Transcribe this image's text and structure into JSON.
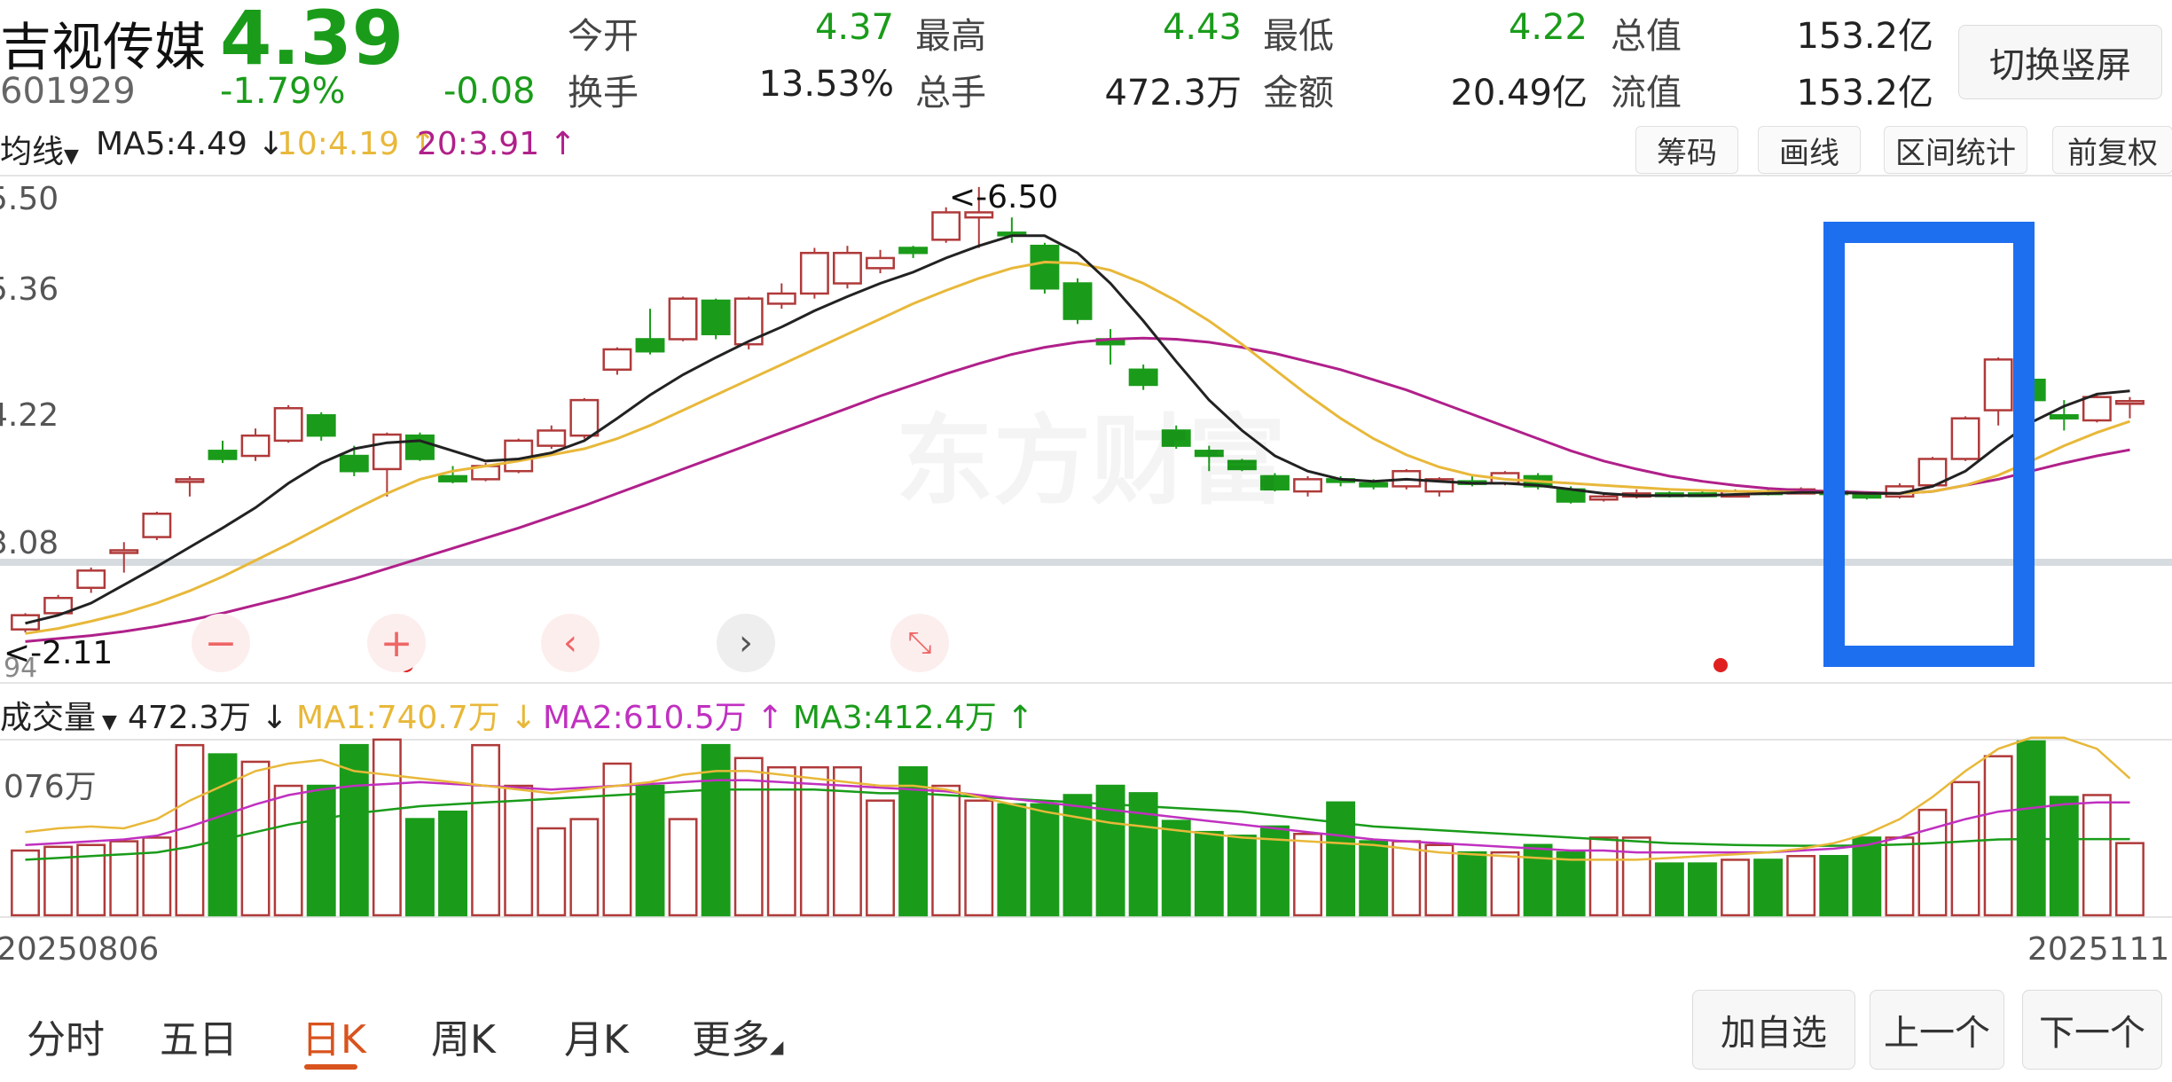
{
  "header": {
    "name": "吉视传媒",
    "price": "4.39",
    "code": "601929",
    "change_pct": "-1.79%",
    "change": "-0.08",
    "quotes": [
      {
        "label": "今开",
        "value": "4.37",
        "color": "#1a9c1a"
      },
      {
        "label": "最高",
        "value": "4.43",
        "color": "#1a9c1a"
      },
      {
        "label": "最低",
        "value": "4.22",
        "color": "#1a9c1a"
      },
      {
        "label": "总值",
        "value": "153.2亿",
        "color": "#222222"
      },
      {
        "label": "换手",
        "value": "13.53%",
        "color": "#222222"
      },
      {
        "label": "总手",
        "value": "472.3万",
        "color": "#222222"
      },
      {
        "label": "金额",
        "value": "20.49亿",
        "color": "#222222"
      },
      {
        "label": "流值",
        "value": "153.2亿",
        "color": "#222222"
      }
    ],
    "switch_button": "切换竖屏"
  },
  "ma_bar": {
    "selector": "均线",
    "ma5": "MA5:4.49",
    "ma10": "10:4.19",
    "ma20": "20:3.91",
    "ma5_color": "#222222",
    "ma10_color": "#e8b83a",
    "ma20_color": "#b0208a",
    "tools": [
      "筹码",
      "画线",
      "区间统计",
      "前复权"
    ]
  },
  "price_axis": [
    "5.50",
    "5.36",
    "4.22",
    "3.08"
  ],
  "markers": {
    "high": "<-6.50",
    "low": "<-2.11",
    "low_partial": "94"
  },
  "watermark": "东方财富",
  "volume_bar": {
    "selector": "成交量",
    "volume": "472.3万",
    "ma1": "MA1:740.7万",
    "ma2": "MA2:610.5万",
    "ma3": "MA3:412.4万",
    "ma1_color": "#e8b83a",
    "ma2_color": "#c030c0",
    "ma3_color": "#1a9c1a",
    "axis_label": "076万"
  },
  "dates": {
    "start": "20250806",
    "end": "20251111"
  },
  "tabs": [
    "分时",
    "五日",
    "日K",
    "周K",
    "月K",
    "更多"
  ],
  "active_tab": "日K",
  "bottom_buttons": [
    "加自选",
    "上一个",
    "下一个"
  ],
  "colors": {
    "up": "#b03a3a",
    "down": "#1a9c1a",
    "highlight": "#1e6ff0"
  },
  "chart_data": {
    "type": "candlestick",
    "dates_range": [
      "20250806",
      "20251111"
    ],
    "candles": [
      {
        "o": 2.14,
        "c": 2.28,
        "h": 2.3,
        "l": 2.11
      },
      {
        "o": 2.3,
        "c": 2.45,
        "h": 2.48,
        "l": 2.28
      },
      {
        "o": 2.55,
        "c": 2.72,
        "h": 2.75,
        "l": 2.5
      },
      {
        "o": 2.9,
        "c": 2.92,
        "h": 3.0,
        "l": 2.7
      },
      {
        "o": 3.05,
        "c": 3.28,
        "h": 3.3,
        "l": 3.02
      },
      {
        "o": 3.6,
        "c": 3.62,
        "h": 3.65,
        "l": 3.45
      },
      {
        "o": 3.9,
        "c": 3.82,
        "h": 4.0,
        "l": 3.78
      },
      {
        "o": 3.85,
        "c": 4.05,
        "h": 4.12,
        "l": 3.8
      },
      {
        "o": 4.0,
        "c": 4.32,
        "h": 4.35,
        "l": 3.98
      },
      {
        "o": 4.25,
        "c": 4.05,
        "h": 4.28,
        "l": 4.0
      },
      {
        "o": 3.85,
        "c": 3.7,
        "h": 3.95,
        "l": 3.65
      },
      {
        "o": 3.72,
        "c": 4.06,
        "h": 4.08,
        "l": 3.45
      },
      {
        "o": 4.05,
        "c": 3.82,
        "h": 4.08,
        "l": 3.8
      },
      {
        "o": 3.65,
        "c": 3.6,
        "h": 3.75,
        "l": 3.58
      },
      {
        "o": 3.62,
        "c": 3.75,
        "h": 3.78,
        "l": 3.6
      },
      {
        "o": 3.7,
        "c": 4.0,
        "h": 4.02,
        "l": 3.68
      },
      {
        "o": 3.95,
        "c": 4.1,
        "h": 4.15,
        "l": 3.92
      },
      {
        "o": 4.05,
        "c": 4.4,
        "h": 4.42,
        "l": 4.02
      },
      {
        "o": 4.7,
        "c": 4.9,
        "h": 4.92,
        "l": 4.65
      },
      {
        "o": 5.0,
        "c": 4.88,
        "h": 5.3,
        "l": 4.85
      },
      {
        "o": 5.0,
        "c": 5.4,
        "h": 5.42,
        "l": 4.98
      },
      {
        "o": 5.38,
        "c": 5.05,
        "h": 5.4,
        "l": 5.0
      },
      {
        "o": 4.95,
        "c": 5.4,
        "h": 5.42,
        "l": 4.9
      },
      {
        "o": 5.35,
        "c": 5.45,
        "h": 5.55,
        "l": 5.3
      },
      {
        "o": 5.45,
        "c": 5.85,
        "h": 5.9,
        "l": 5.4
      },
      {
        "o": 5.55,
        "c": 5.85,
        "h": 5.92,
        "l": 5.5
      },
      {
        "o": 5.7,
        "c": 5.8,
        "h": 5.88,
        "l": 5.65
      },
      {
        "o": 5.9,
        "c": 5.85,
        "h": 5.92,
        "l": 5.8
      },
      {
        "o": 5.98,
        "c": 6.25,
        "h": 6.3,
        "l": 5.95
      },
      {
        "o": 6.2,
        "c": 6.25,
        "h": 6.5,
        "l": 5.9
      },
      {
        "o": 6.05,
        "c": 6.03,
        "h": 6.2,
        "l": 5.95
      },
      {
        "o": 5.92,
        "c": 5.5,
        "h": 5.95,
        "l": 5.45
      },
      {
        "o": 5.55,
        "c": 5.2,
        "h": 5.6,
        "l": 5.15
      },
      {
        "o": 5.0,
        "c": 4.95,
        "h": 5.1,
        "l": 4.75
      },
      {
        "o": 4.7,
        "c": 4.55,
        "h": 4.75,
        "l": 4.5
      },
      {
        "o": 4.1,
        "c": 3.95,
        "h": 4.15,
        "l": 3.92
      },
      {
        "o": 3.9,
        "c": 3.85,
        "h": 3.95,
        "l": 3.7
      },
      {
        "o": 3.8,
        "c": 3.72,
        "h": 3.82,
        "l": 3.7
      },
      {
        "o": 3.65,
        "c": 3.52,
        "h": 3.68,
        "l": 3.5
      },
      {
        "o": 3.5,
        "c": 3.62,
        "h": 3.65,
        "l": 3.45
      },
      {
        "o": 3.62,
        "c": 3.6,
        "h": 3.65,
        "l": 3.55
      },
      {
        "o": 3.58,
        "c": 3.55,
        "h": 3.62,
        "l": 3.52
      },
      {
        "o": 3.55,
        "c": 3.7,
        "h": 3.72,
        "l": 3.52
      },
      {
        "o": 3.5,
        "c": 3.62,
        "h": 3.64,
        "l": 3.45
      },
      {
        "o": 3.6,
        "c": 3.58,
        "h": 3.66,
        "l": 3.55
      },
      {
        "o": 3.58,
        "c": 3.68,
        "h": 3.7,
        "l": 3.56
      },
      {
        "o": 3.65,
        "c": 3.55,
        "h": 3.68,
        "l": 3.52
      },
      {
        "o": 3.52,
        "c": 3.4,
        "h": 3.55,
        "l": 3.38
      },
      {
        "o": 3.42,
        "c": 3.45,
        "h": 3.48,
        "l": 3.4
      },
      {
        "o": 3.45,
        "c": 3.48,
        "h": 3.52,
        "l": 3.43
      },
      {
        "o": 3.48,
        "c": 3.46,
        "h": 3.5,
        "l": 3.44
      },
      {
        "o": 3.48,
        "c": 3.47,
        "h": 3.52,
        "l": 3.45
      },
      {
        "o": 3.45,
        "c": 3.5,
        "h": 3.52,
        "l": 3.44
      },
      {
        "o": 3.5,
        "c": 3.48,
        "h": 3.53,
        "l": 3.46
      },
      {
        "o": 3.48,
        "c": 3.52,
        "h": 3.54,
        "l": 3.47
      },
      {
        "o": 3.5,
        "c": 3.48,
        "h": 3.52,
        "l": 3.46
      },
      {
        "o": 3.48,
        "c": 3.44,
        "h": 3.5,
        "l": 3.42
      },
      {
        "o": 3.45,
        "c": 3.55,
        "h": 3.58,
        "l": 3.43
      },
      {
        "o": 3.56,
        "c": 3.82,
        "h": 3.84,
        "l": 3.55
      },
      {
        "o": 3.82,
        "c": 4.22,
        "h": 4.24,
        "l": 3.8
      },
      {
        "o": 4.3,
        "c": 4.8,
        "h": 4.82,
        "l": 4.15
      },
      {
        "o": 4.6,
        "c": 4.4,
        "h": 4.75,
        "l": 4.35
      },
      {
        "o": 4.25,
        "c": 4.22,
        "h": 4.4,
        "l": 4.1
      },
      {
        "o": 4.2,
        "c": 4.43,
        "h": 4.45,
        "l": 4.18
      },
      {
        "o": 4.37,
        "c": 4.39,
        "h": 4.43,
        "l": 4.22
      }
    ],
    "ma5": [
      2.2,
      2.28,
      2.4,
      2.58,
      2.76,
      2.95,
      3.14,
      3.34,
      3.58,
      3.78,
      3.92,
      3.98,
      4.0,
      3.9,
      3.8,
      3.82,
      3.88,
      4.0,
      4.22,
      4.45,
      4.65,
      4.82,
      4.98,
      5.12,
      5.28,
      5.42,
      5.55,
      5.66,
      5.8,
      5.92,
      6.02,
      6.02,
      5.85,
      5.55,
      5.18,
      4.78,
      4.4,
      4.1,
      3.85,
      3.7,
      3.62,
      3.6,
      3.62,
      3.6,
      3.58,
      3.58,
      3.56,
      3.52,
      3.48,
      3.46,
      3.46,
      3.46,
      3.47,
      3.48,
      3.49,
      3.49,
      3.48,
      3.48,
      3.55,
      3.7,
      3.95,
      4.18,
      4.34,
      4.46,
      4.49
    ],
    "ma10": [
      2.1,
      2.15,
      2.22,
      2.3,
      2.4,
      2.52,
      2.66,
      2.82,
      2.98,
      3.15,
      3.32,
      3.48,
      3.62,
      3.7,
      3.75,
      3.8,
      3.86,
      3.92,
      4.02,
      4.15,
      4.3,
      4.45,
      4.6,
      4.75,
      4.9,
      5.05,
      5.2,
      5.35,
      5.48,
      5.6,
      5.7,
      5.76,
      5.75,
      5.68,
      5.55,
      5.38,
      5.18,
      4.95,
      4.7,
      4.45,
      4.22,
      4.02,
      3.86,
      3.74,
      3.66,
      3.62,
      3.6,
      3.58,
      3.56,
      3.54,
      3.52,
      3.51,
      3.5,
      3.5,
      3.49,
      3.49,
      3.48,
      3.48,
      3.5,
      3.56,
      3.66,
      3.8,
      3.95,
      4.08,
      4.19
    ],
    "ma20": [
      2.02,
      2.05,
      2.08,
      2.12,
      2.17,
      2.23,
      2.3,
      2.38,
      2.46,
      2.55,
      2.64,
      2.74,
      2.84,
      2.94,
      3.04,
      3.14,
      3.25,
      3.36,
      3.48,
      3.6,
      3.72,
      3.84,
      3.96,
      4.08,
      4.2,
      4.32,
      4.44,
      4.55,
      4.66,
      4.76,
      4.85,
      4.92,
      4.97,
      5.0,
      5.01,
      5.0,
      4.97,
      4.92,
      4.86,
      4.78,
      4.7,
      4.6,
      4.5,
      4.38,
      4.26,
      4.14,
      4.02,
      3.9,
      3.8,
      3.72,
      3.65,
      3.6,
      3.56,
      3.53,
      3.51,
      3.5,
      3.49,
      3.48,
      3.5,
      3.56,
      3.62,
      3.7,
      3.78,
      3.85,
      3.91
    ],
    "volume": [
      350,
      370,
      380,
      400,
      420,
      920,
      870,
      830,
      700,
      700,
      920,
      950,
      520,
      560,
      920,
      700,
      470,
      520,
      820,
      700,
      520,
      920,
      850,
      800,
      800,
      800,
      620,
      800,
      700,
      620,
      600,
      600,
      650,
      700,
      660,
      510,
      450,
      430,
      480,
      440,
      610,
      400,
      400,
      380,
      340,
      340,
      380,
      340,
      420,
      420,
      280,
      280,
      300,
      300,
      320,
      320,
      420,
      420,
      570,
      720,
      860,
      940,
      640,
      650,
      390
    ],
    "vol_ma1": [
      450,
      470,
      480,
      470,
      520,
      620,
      700,
      780,
      820,
      840,
      780,
      760,
      740,
      720,
      700,
      680,
      660,
      680,
      700,
      720,
      760,
      780,
      780,
      760,
      740,
      720,
      700,
      700,
      680,
      640,
      600,
      560,
      530,
      500,
      480,
      460,
      440,
      420,
      410,
      400,
      390,
      380,
      360,
      340,
      330,
      320,
      310,
      300,
      300,
      300,
      310,
      320,
      330,
      340,
      360,
      390,
      440,
      520,
      640,
      780,
      900,
      960,
      960,
      900,
      740
    ],
    "vol_ma2": [
      380,
      390,
      400,
      410,
      430,
      480,
      540,
      600,
      650,
      680,
      700,
      710,
      720,
      710,
      700,
      690,
      680,
      690,
      700,
      710,
      720,
      730,
      730,
      720,
      710,
      700,
      690,
      680,
      670,
      650,
      630,
      610,
      590,
      570,
      550,
      530,
      510,
      490,
      470,
      450,
      430,
      410,
      400,
      390,
      380,
      370,
      360,
      350,
      350,
      340,
      340,
      340,
      340,
      340,
      350,
      360,
      380,
      420,
      470,
      520,
      560,
      580,
      600,
      610,
      610
    ],
    "vol_ma3": [
      300,
      310,
      320,
      330,
      340,
      370,
      410,
      450,
      490,
      520,
      550,
      570,
      590,
      600,
      610,
      620,
      630,
      640,
      650,
      660,
      670,
      680,
      680,
      680,
      680,
      670,
      660,
      660,
      650,
      640,
      630,
      620,
      610,
      600,
      590,
      580,
      570,
      560,
      540,
      520,
      500,
      480,
      470,
      460,
      450,
      440,
      430,
      420,
      410,
      400,
      390,
      385,
      380,
      378,
      376,
      376,
      378,
      382,
      390,
      400,
      410,
      412,
      412,
      412,
      412
    ]
  }
}
